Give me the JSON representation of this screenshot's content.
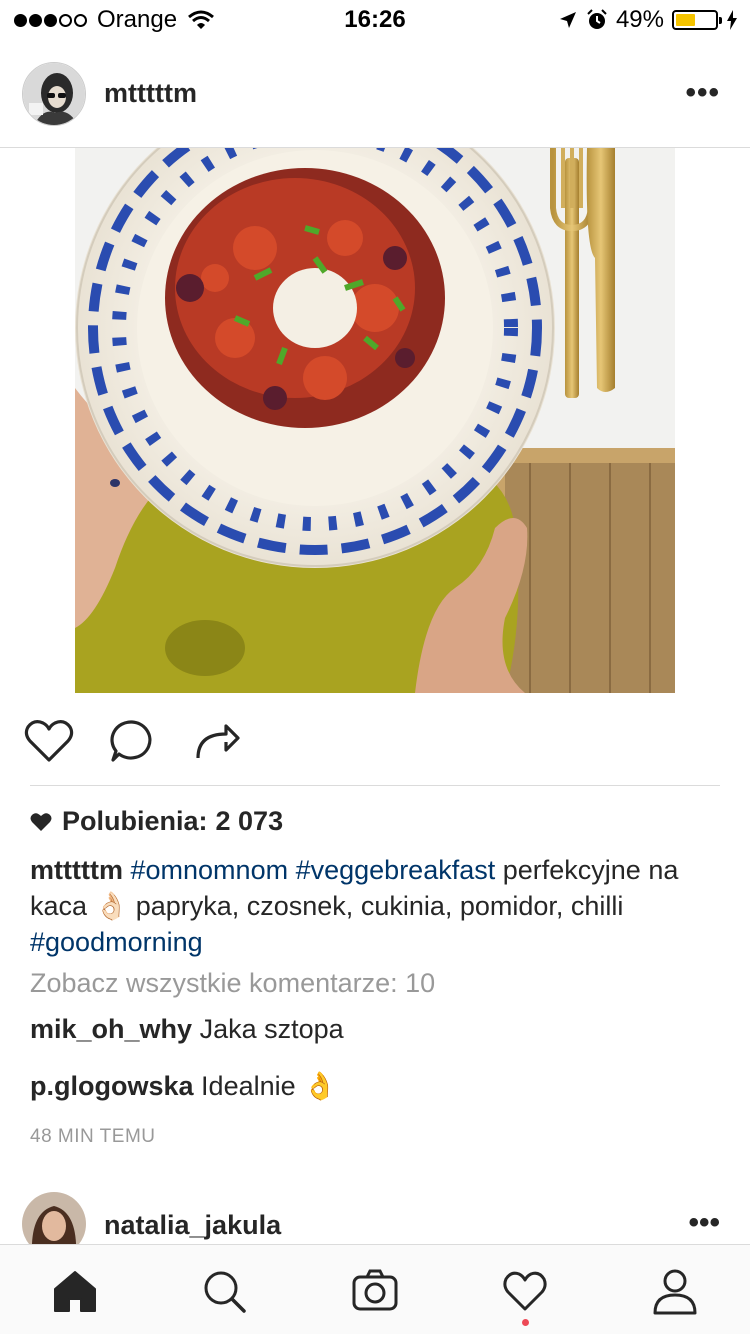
{
  "status_bar": {
    "carrier": "Orange",
    "time": "16:26",
    "battery_percent": "49%",
    "battery_level": 0.49,
    "signal_bars": 3,
    "signal_total": 5
  },
  "post": {
    "username": "mtttttm",
    "more": "•••",
    "likes_label": "Polubienia:",
    "likes_count": "2 073",
    "caption": {
      "username": "mtttttm",
      "tag1": "#omnomnom",
      "tag2": "#veggebreakfast",
      "text1": "perfekcyjne na kaca",
      "emoji": "👌🏻",
      "text2": "papryka, czosnek, cukinia, pomidor, chilli",
      "tag3": "#goodmorning"
    },
    "view_all_comments": "Zobacz wszystkie komentarze: 10",
    "comments": [
      {
        "user": "mik_oh_why",
        "text": "Jaka sztopa"
      },
      {
        "user": "p.glogowska",
        "text": "Idealnie",
        "emoji": "👌"
      }
    ],
    "time_ago": "48 MIN TEMU"
  },
  "next_post": {
    "username": "natalia_jakula",
    "more": "•••"
  },
  "icons": {
    "like": "heart-icon",
    "comment": "comment-icon",
    "share": "share-icon",
    "home": "home-icon",
    "search": "search-icon",
    "camera": "camera-icon",
    "activity": "heart-icon",
    "profile": "profile-icon"
  },
  "colors": {
    "hashtag": "#003569",
    "muted": "#999999",
    "notification": "#ed4956",
    "battery": "#f5c400"
  }
}
